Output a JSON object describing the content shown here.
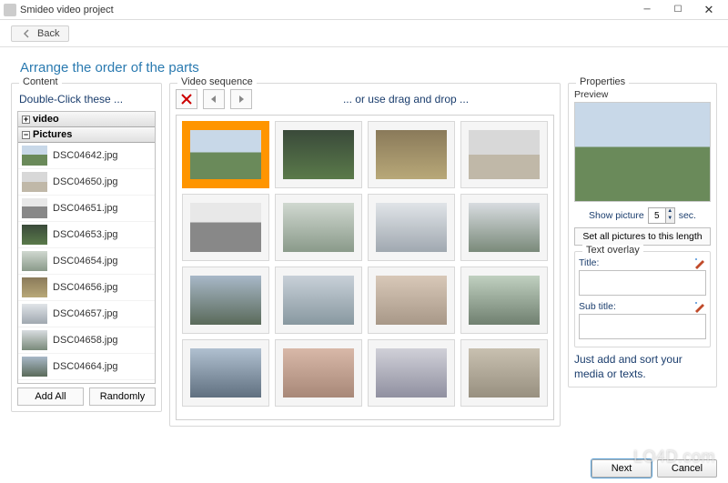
{
  "window": {
    "title": "Smideo video project"
  },
  "nav": {
    "back": "Back"
  },
  "heading": "Arrange the order of the parts",
  "content": {
    "legend": "Content",
    "hint": "Double-Click these ...",
    "nodes": {
      "video": "video",
      "pictures": "Pictures"
    },
    "files": [
      {
        "name": "DSC04642.jpg"
      },
      {
        "name": "DSC04650.jpg"
      },
      {
        "name": "DSC04651.jpg"
      },
      {
        "name": "DSC04653.jpg"
      },
      {
        "name": "DSC04654.jpg"
      },
      {
        "name": "DSC04656.jpg"
      },
      {
        "name": "DSC04657.jpg"
      },
      {
        "name": "DSC04658.jpg"
      },
      {
        "name": "DSC04664.jpg"
      }
    ],
    "add_all": "Add All",
    "randomly": "Randomly"
  },
  "sequence": {
    "legend": "Video sequence",
    "hint": "... or use drag and drop ..."
  },
  "properties": {
    "legend": "Properties",
    "preview_label": "Preview",
    "show_picture": "Show picture",
    "duration": "5",
    "sec": "sec.",
    "set_all": "Set all pictures to this length",
    "text_overlay": "Text overlay",
    "title_label": "Title:",
    "subtitle_label": "Sub title:",
    "tip": "Just add and sort your media or texts."
  },
  "footer": {
    "next": "Next",
    "cancel": "Cancel"
  },
  "watermark": "LO4D.com"
}
